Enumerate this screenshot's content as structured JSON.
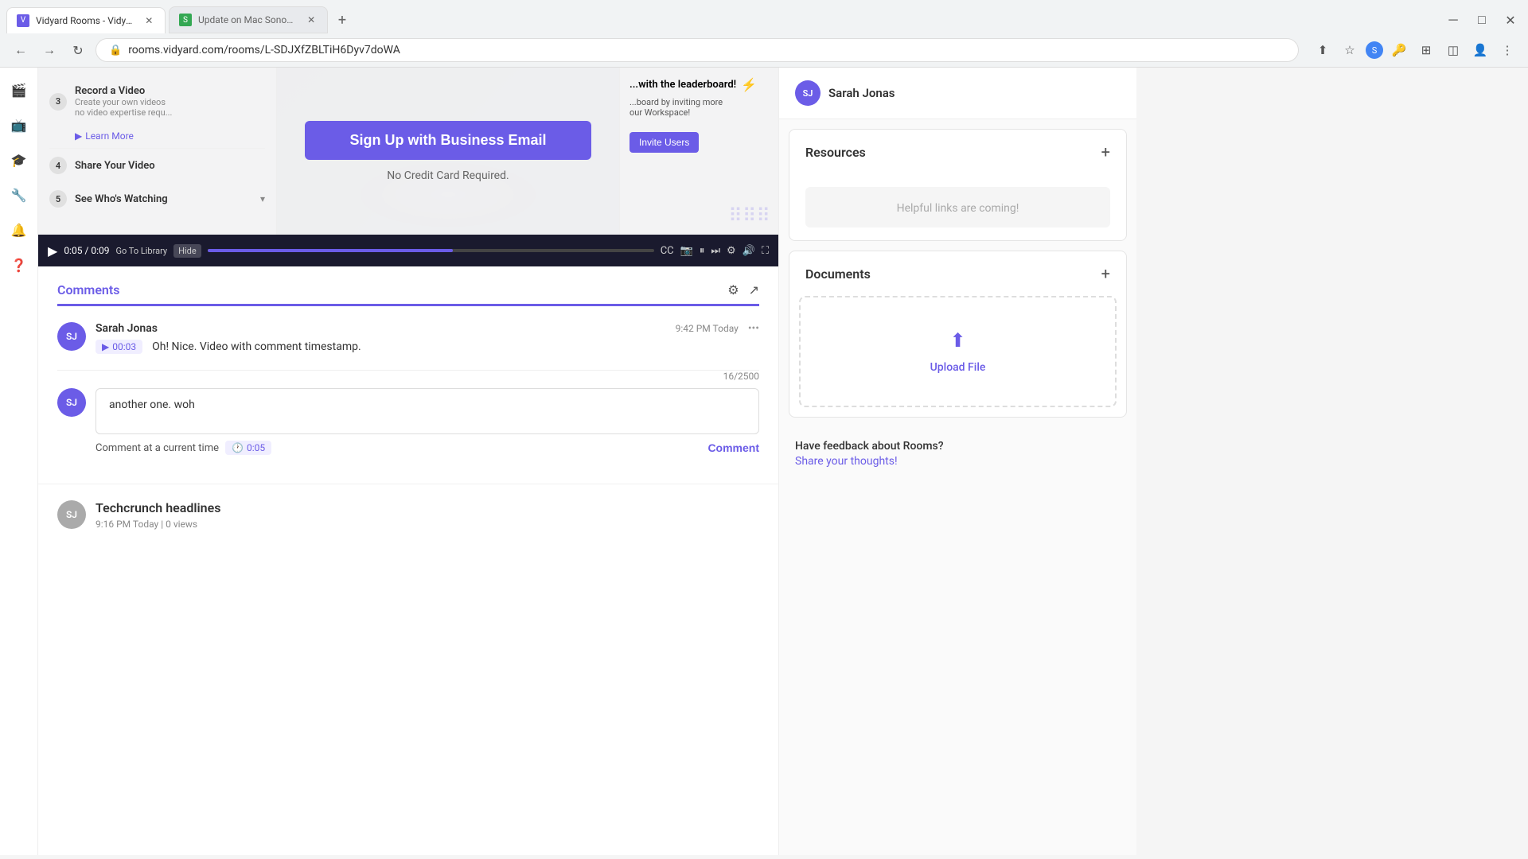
{
  "browser": {
    "tabs": [
      {
        "id": "tab1",
        "favicon": "V",
        "favicon_color": "purple",
        "title": "Vidyard Rooms - Vidyard",
        "active": true
      },
      {
        "id": "tab2",
        "favicon": "S",
        "favicon_color": "green",
        "title": "Update on Mac Sonoma",
        "active": false
      }
    ],
    "url": "rooms.vidyard.com/rooms/L-SDJXfZBLTiH6Dyv7doWA",
    "nav": {
      "back": "←",
      "forward": "→",
      "refresh": "↻"
    }
  },
  "sidebar_left": {
    "icons": [
      "🎬",
      "📺",
      "🎓",
      "🔧",
      "🔔",
      "❓"
    ]
  },
  "video": {
    "steps": [
      {
        "num": "3",
        "label": "Record a Video",
        "desc": "Create your own videos\nno video expertise requ..."
      },
      {
        "num": "4",
        "label": "Share Your Video",
        "desc": ""
      },
      {
        "num": "5",
        "label": "See Who's Watching",
        "desc": ""
      }
    ],
    "cta": {
      "button_label": "Sign Up with Business Email",
      "subtitle": "No Credit Card Required.",
      "learn_more": "Learn More"
    },
    "leaderboard": {
      "title": "...with the leaderboard!",
      "body": "...board by inviting more\nour Workspace!",
      "invite_btn": "Invite Users"
    },
    "controls": {
      "current_time": "0:05",
      "total_time": "0:09",
      "progress_percent": 55,
      "hide_label": "Hide",
      "go_to_library": "Go To Library"
    }
  },
  "comments": {
    "title": "Comments",
    "char_count": "16/2500",
    "items": [
      {
        "author": "Sarah Jonas",
        "initials": "SJ",
        "time": "9:42 PM Today",
        "timestamp": "00:03",
        "text": "Oh! Nice. Video with comment timestamp."
      }
    ],
    "input_value": "another one. woh",
    "input_placeholder": "",
    "at_time_label": "Comment at a current time",
    "time_value": "0:05",
    "submit_label": "Comment"
  },
  "techcrunch_post": {
    "title": "Techcrunch headlines",
    "meta": "9:16 PM Today  |  0 views",
    "initials": "SJ"
  },
  "right_sidebar": {
    "user": {
      "name": "Sarah Jonas",
      "initials": "SJ"
    },
    "resources": {
      "title": "Resources",
      "placeholder": "Helpful links are coming!"
    },
    "documents": {
      "title": "Documents",
      "upload_label": "Upload File"
    },
    "feedback": {
      "title": "Have feedback about Rooms?",
      "link_label": "Share your thoughts!"
    }
  }
}
